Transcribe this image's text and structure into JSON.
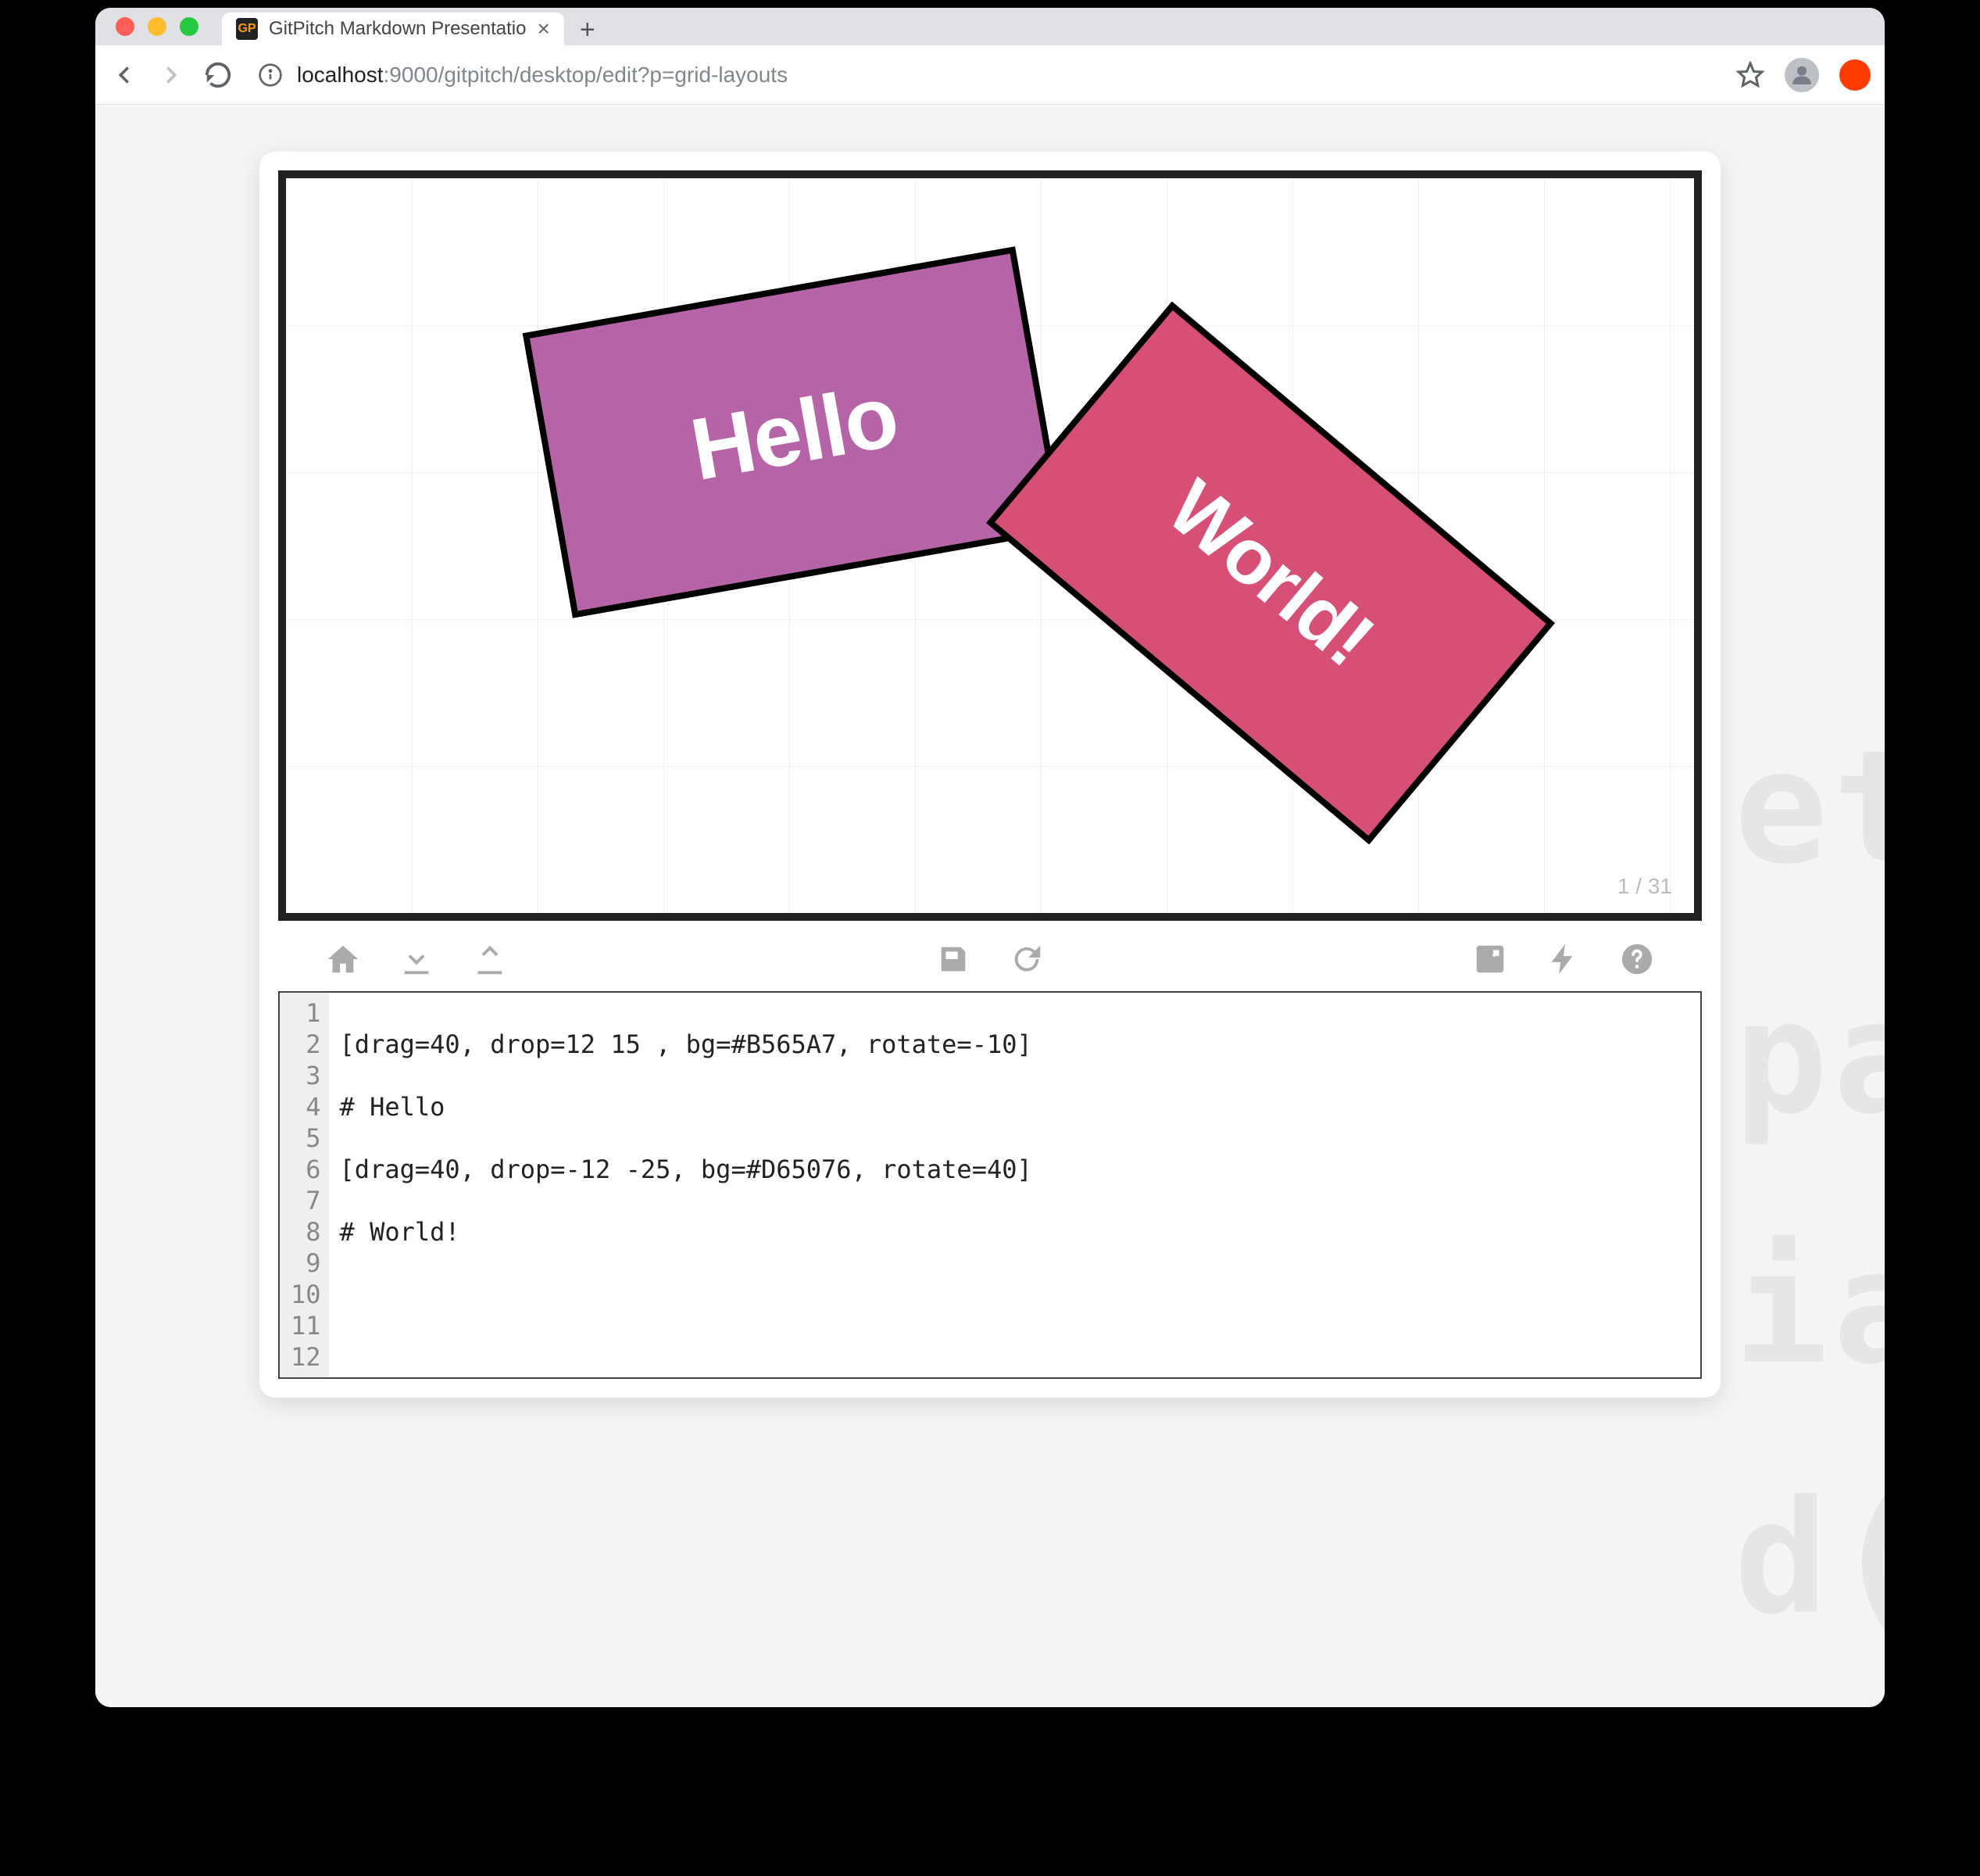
{
  "browser": {
    "tab_title": "GitPitch Markdown Presentatio",
    "tab_favicon_text": "GP",
    "url_prefix": "localhost",
    "url_suffix": ":9000/gitpitch/desktop/edit?p=grid-layouts"
  },
  "slide": {
    "box1": {
      "text": "Hello",
      "bg": "#B565A7",
      "rotate": -10
    },
    "box2": {
      "text": "World!",
      "bg": "#D65076",
      "rotate": 40
    },
    "counter": "1 / 31"
  },
  "toolbar": {
    "left": [
      "home",
      "download",
      "upload"
    ],
    "center": [
      "save",
      "refresh"
    ],
    "right": [
      "fullscreen",
      "bolt",
      "help"
    ]
  },
  "editor": {
    "lines": [
      "",
      "[drag=40, drop=12 15 , bg=#B565A7, rotate=-10]",
      "",
      "# Hello",
      "",
      "[drag=40, drop=-12 -25, bg=#D65076, rotate=40]",
      "",
      "# World!",
      "",
      "",
      "",
      ""
    ]
  },
  "ghost": [
    "et",
    "pa",
    "ia",
    "d("
  ]
}
